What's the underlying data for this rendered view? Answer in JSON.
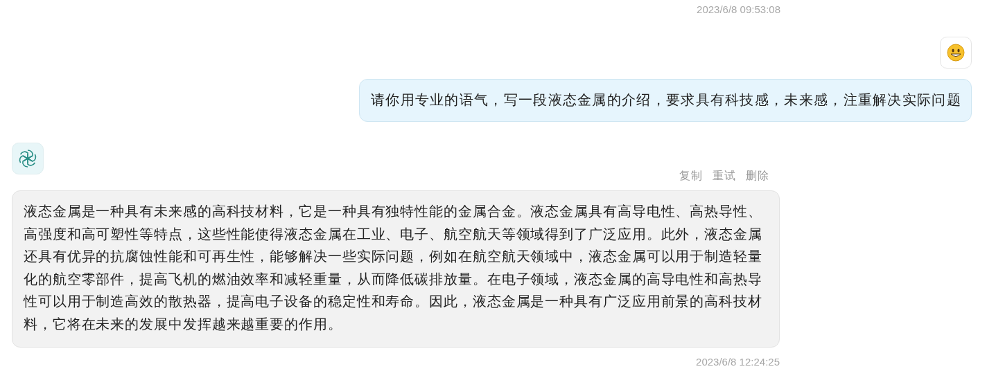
{
  "messages": [
    {
      "kind": "question",
      "time": "2023/6/8 09:53:08",
      "text": "请你用专业的语气，写一段液态金属的介绍，要求具有科技感，未来感，注重解决实际问题"
    },
    {
      "kind": "answer",
      "actions": [
        "复制",
        "重试",
        "删除"
      ],
      "text": "液态金属是一种具有未来感的高科技材料，它是一种具有独特性能的金属合金。液态金属具有高导电性、高热导性、高强度和高可塑性等特点，这些性能使得液态金属在工业、电子、航空航天等领域得到了广泛应用。此外，液态金属还具有优异的抗腐蚀性能和可再生性，能够解决一些实际问题，例如在航空航天领域中，液态金属可以用于制造轻量化的航空零部件，提高飞机的燃油效率和减轻重量，从而降低碳排放量。在电子领域，液态金属的高导电性和高热导性可以用于制造高效的散热器，提高电子设备的稳定性和寿命。因此，液态金属是一种具有广泛应用前景的高科技材料，它将在未来的发展中发挥越来越重要的作用。",
      "time": "2023/6/8 12:24:25"
    }
  ]
}
